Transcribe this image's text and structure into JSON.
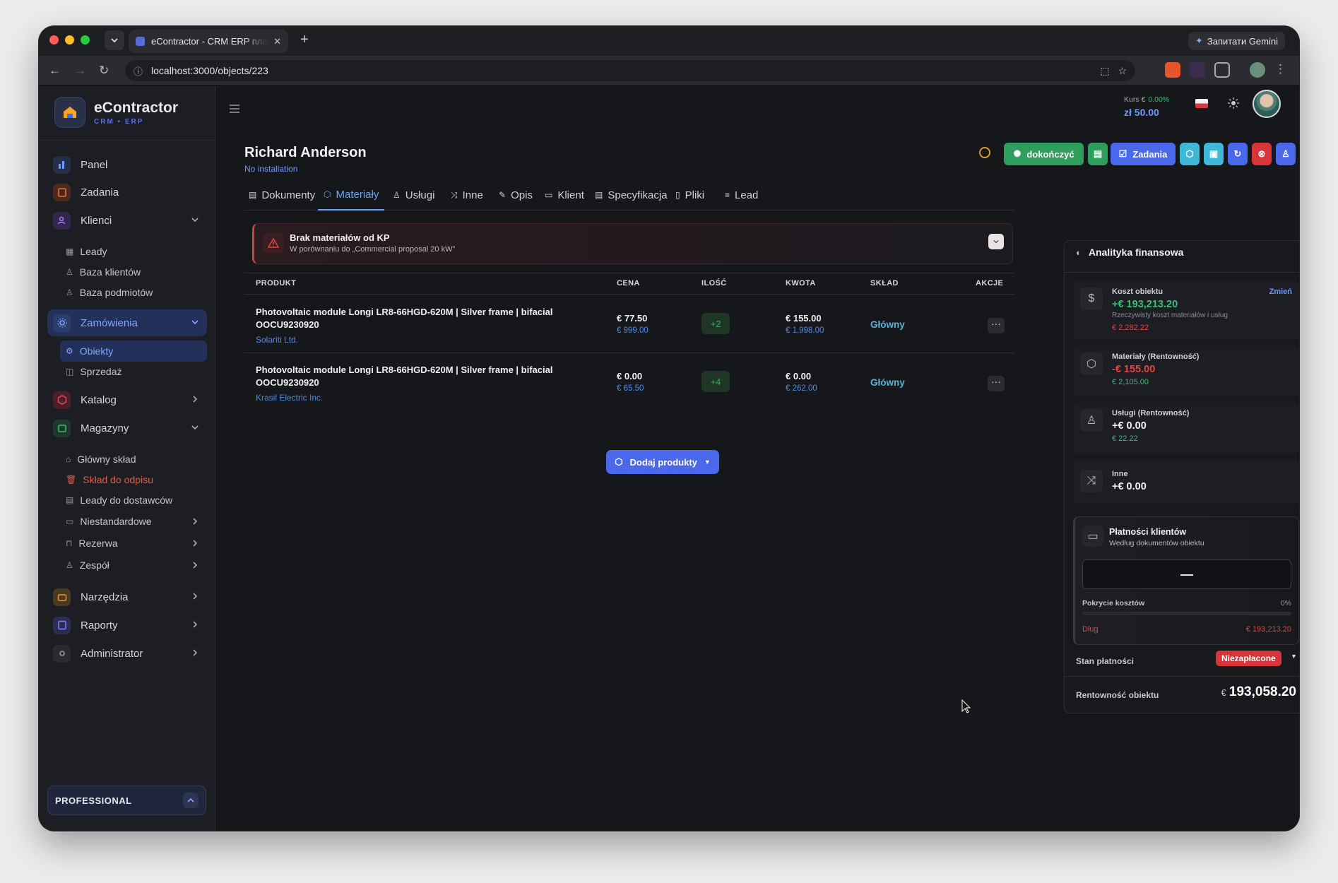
{
  "browser": {
    "tab_title": "eContractor - CRM ERP платф",
    "url": "localhost:3000/objects/223",
    "gemini_label": "Запитати Gemini"
  },
  "brand": {
    "name": "eContractor",
    "sub": "CRM • ERP"
  },
  "sidebar": {
    "items": [
      {
        "label": "Panel"
      },
      {
        "label": "Zadania"
      },
      {
        "label": "Klienci"
      },
      {
        "label": "Leady"
      },
      {
        "label": "Baza klientów"
      },
      {
        "label": "Baza podmiotów"
      },
      {
        "label": "Zamówienia"
      },
      {
        "label": "Obiekty"
      },
      {
        "label": "Sprzedaż"
      },
      {
        "label": "Katalog"
      },
      {
        "label": "Magazyny"
      },
      {
        "label": "Główny skład"
      },
      {
        "label": "Skład do odpisu"
      },
      {
        "label": "Leady do dostawców"
      },
      {
        "label": "Niestandardowe"
      },
      {
        "label": "Rezerwa"
      },
      {
        "label": "Zespół"
      },
      {
        "label": "Narzędzia"
      },
      {
        "label": "Raporty"
      },
      {
        "label": "Administrator"
      }
    ],
    "plan": "PROFESSIONAL"
  },
  "header": {
    "kurs_label": "Kurs €",
    "kurs_pct": "0.00%",
    "kurs_value": "zł 50.00"
  },
  "object": {
    "name": "Richard Anderson",
    "subtitle": "No installation"
  },
  "actions": {
    "finish": "dokończyć",
    "tasks": "Zadania"
  },
  "tabs": [
    {
      "label": "Dokumenty"
    },
    {
      "label": "Materiały"
    },
    {
      "label": "Usługi"
    },
    {
      "label": "Inne"
    },
    {
      "label": "Opis"
    },
    {
      "label": "Klient"
    },
    {
      "label": "Specyfikacja"
    },
    {
      "label": "Pliki"
    },
    {
      "label": "Lead"
    }
  ],
  "alert": {
    "title": "Brak materiałów od KP",
    "text": "W porównaniu do „Commercial proposal 20 kW”"
  },
  "table": {
    "headers": [
      "PRODUKT",
      "CENA",
      "ILOŚĆ",
      "KWOTA",
      "SKŁAD",
      "AKCJE"
    ],
    "rows": [
      {
        "product": "Photovoltaic module Longi LR8-66HGD-620M | Silver frame | bifacial OOCU9230920",
        "vendor": "Solariti Ltd.",
        "price": "€ 77.50",
        "price_sub": "€ 999.00",
        "qty": "+2",
        "amount": "€ 155.00",
        "amount_sub": "€ 1,998.00",
        "warehouse": "Główny"
      },
      {
        "product": "Photovoltaic module Longi LR8-66HGD-620M | Silver frame | bifacial OOCU9230920",
        "vendor": "Krasil Electric Inc.",
        "price": "€ 0.00",
        "price_sub": "€ 65.50",
        "qty": "+4",
        "amount": "€ 0.00",
        "amount_sub": "€ 262.00",
        "warehouse": "Główny"
      }
    ],
    "add_button": "Dodaj produkty"
  },
  "analytics": {
    "title": "Analityka finansowa",
    "cost": {
      "label": "Koszt obiektu",
      "change": "Zmień",
      "value": "+€ 193,213.20",
      "note": "Rzeczywisty koszt materiałów i usług",
      "sub": "€ 2,282.22"
    },
    "materials": {
      "label": "Materiały (Rentowność)",
      "value": "-€ 155.00",
      "sub": "€ 2,105.00"
    },
    "services": {
      "label": "Usługi (Rentowność)",
      "value": "+€ 0.00",
      "sub": "€ 22.22"
    },
    "other": {
      "label": "Inne",
      "value": "+€ 0.00"
    },
    "payments": {
      "title": "Płatności klientów",
      "subtitle": "Według dokumentów obiektu",
      "dash": "—",
      "coverage_label": "Pokrycie kosztów",
      "coverage_pct": "0%",
      "debt_label": "Dług",
      "debt_value": "€ 193,213.20"
    },
    "status_label": "Stan płatności",
    "status_value": "Niezapłacone",
    "profit_label": "Rentowność obiektu",
    "profit_currency": "€",
    "profit_value": "193,058.20"
  },
  "colors": {
    "accent": "#4a68ec",
    "success": "#3bbf7a",
    "danger": "#e0463f",
    "link": "#6e99ff"
  }
}
